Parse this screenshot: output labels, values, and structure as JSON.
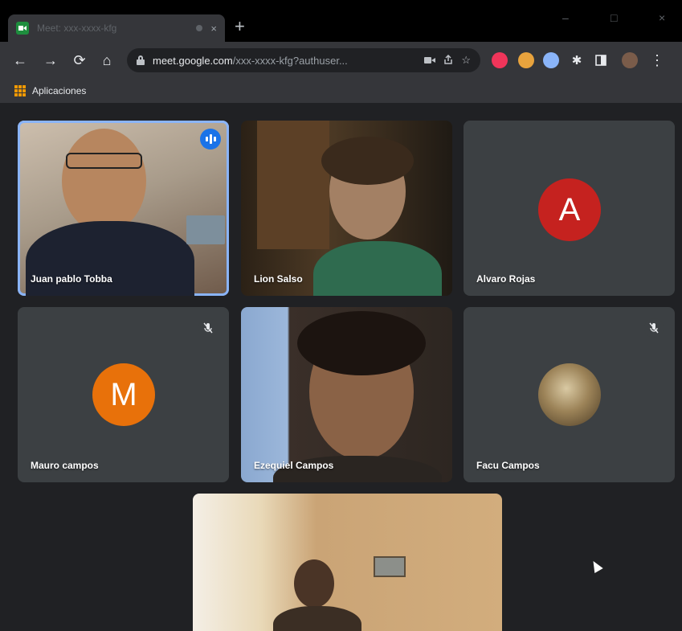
{
  "browser": {
    "tab_title": "Meet: xxx-xxxx-kfg",
    "tab_close": "×",
    "new_tab": "+",
    "window_controls": [
      "–",
      "□",
      "×"
    ],
    "nav": {
      "back": "←",
      "forward": "→",
      "reload": "⟳",
      "home": "⌂"
    },
    "url_host": "meet.google.com",
    "url_path": "/xxx-xxxx-kfg?authuser...",
    "omnibox_icons": [
      "camera-icon",
      "share-icon",
      "star-icon"
    ],
    "extension_icons": [
      "ext-red",
      "ext-avatar",
      "ext-globe",
      "puzzle-icon",
      "sidepanel-icon",
      "profile-avatar",
      "menu-icon"
    ],
    "menu_glyph": "⋮",
    "bookmarks": {
      "apps_label": "Aplicaciones"
    }
  },
  "meet": {
    "accent": "#8ab4f8",
    "participants": [
      {
        "name": "Juan pablo Tobba",
        "video": true,
        "speaking": true
      },
      {
        "name": "Lion Salso",
        "video": true
      },
      {
        "name": "Alvaro Rojas",
        "video": false,
        "initial": "A",
        "avatar_color": "#c5221f"
      },
      {
        "name": "Mauro campos",
        "video": false,
        "initial": "M",
        "avatar_color": "#e8710a",
        "muted": true
      },
      {
        "name": "Ezequiel Campos",
        "video": true
      },
      {
        "name": "Facu Campos",
        "video": false,
        "avatar_image": true,
        "muted": true
      },
      {
        "name": "",
        "video": true
      }
    ]
  }
}
